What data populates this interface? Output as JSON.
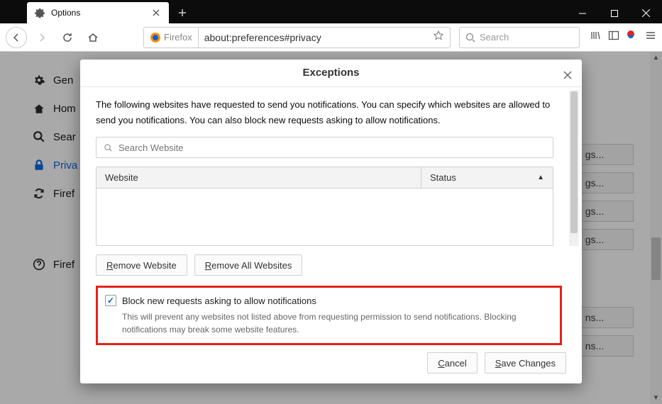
{
  "window": {
    "tab_title": "Options"
  },
  "navbar": {
    "identity_label": "Firefox",
    "url": "about:preferences#privacy",
    "search_placeholder": "Search"
  },
  "sidebar": {
    "general": "Gen",
    "home": "Hom",
    "search": "Sear",
    "privacy": "Priva",
    "sync": "Firef",
    "help": "Firef"
  },
  "settings_buttons": {
    "b1": "gs...",
    "b2": "gs...",
    "b3": "gs...",
    "b4": "gs...",
    "b5": "ns...",
    "b6": "ns..."
  },
  "dialog": {
    "title": "Exceptions",
    "description": "The following websites have requested to send you notifications. You can specify which websites are allowed to send you notifications. You can also block new requests asking to allow notifications.",
    "search_placeholder": "Search Website",
    "col_website": "Website",
    "col_status": "Status",
    "remove_website": "emove Website",
    "remove_all": "emove All Websites",
    "block_label": "Block new requests asking to allow notifications",
    "block_desc": "This will prevent any websites not listed above from requesting permission to send notifications. Blocking notifications may break some website features.",
    "cancel": "ancel",
    "save": "ave Changes"
  }
}
